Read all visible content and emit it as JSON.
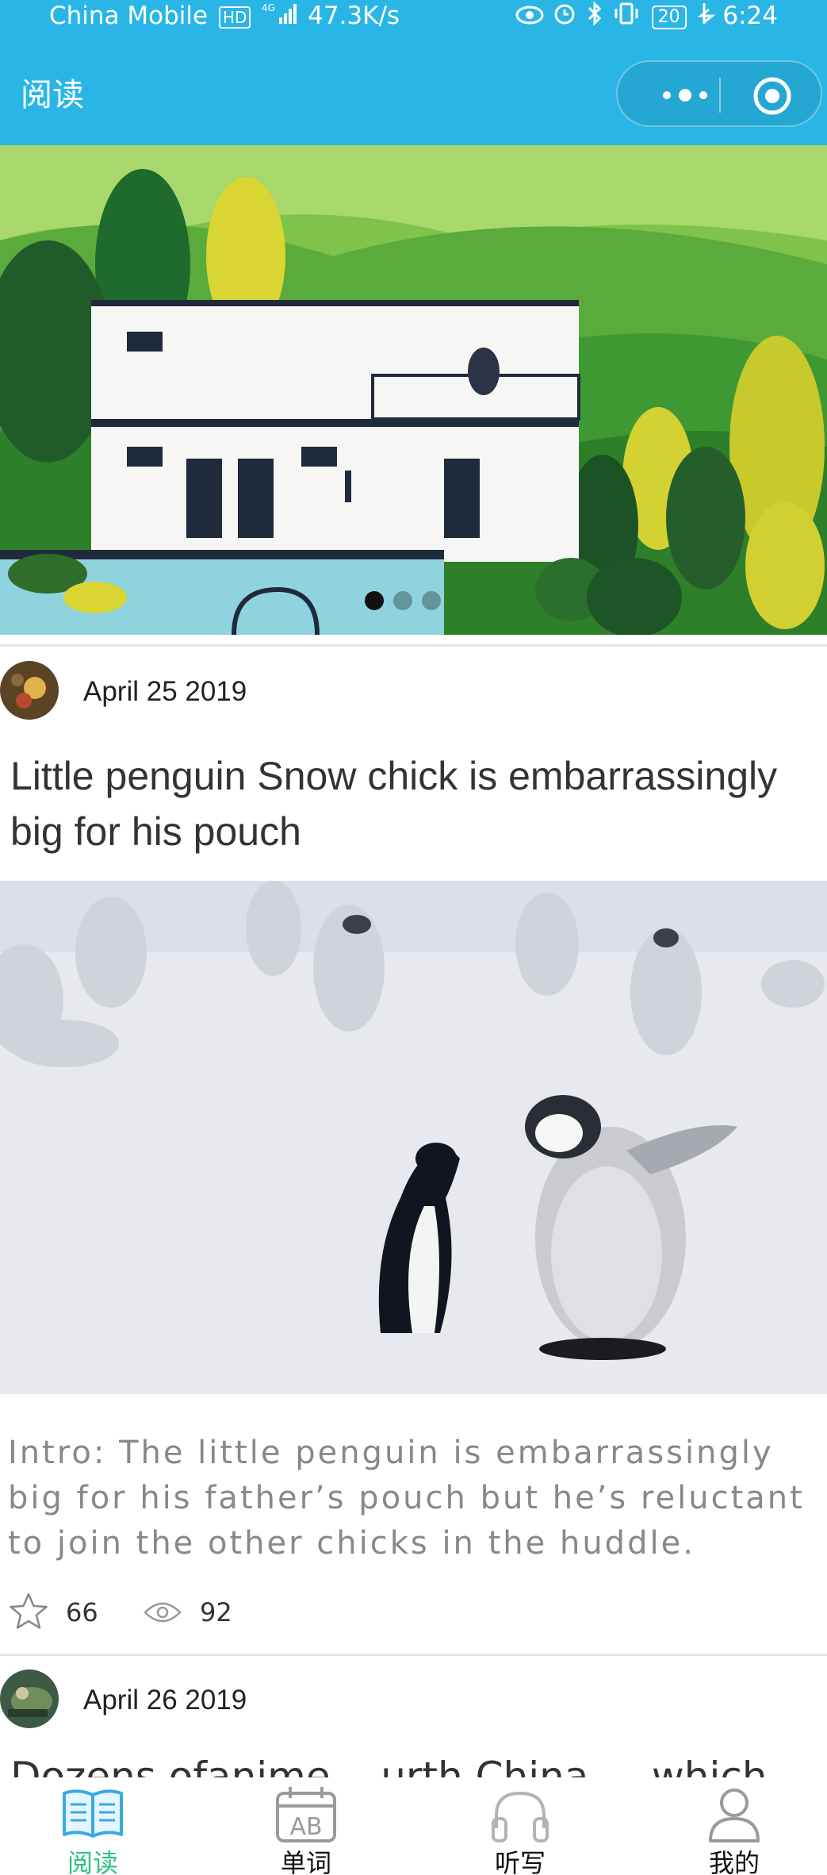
{
  "status_bar": {
    "carrier": "China Mobile",
    "hd": "HD",
    "network": "4G",
    "speed": "47.3K/s",
    "battery": "20",
    "time": "6:24"
  },
  "nav": {
    "title": "阅读"
  },
  "banner": {
    "dot_count": 3,
    "active_index": 0
  },
  "posts": [
    {
      "date": "April 25 2019",
      "title": "Little penguin Snow chick is embarrassingly big for his pouch",
      "intro": "Intro: The little penguin is embarrassingly big for his father’s pouch but he’s reluctant to join the other chicks in the huddle.",
      "stars": "66",
      "views": "92"
    },
    {
      "date": "April 26 2019",
      "title": "Dozens ofanime ...urth China ... which ..."
    }
  ],
  "tabbar": [
    {
      "label": "阅读",
      "icon": "book-icon",
      "active": true
    },
    {
      "label": "单词",
      "icon": "calendar-ab-icon",
      "active": false
    },
    {
      "label": "听写",
      "icon": "headphones-icon",
      "active": false
    },
    {
      "label": "我的",
      "icon": "user-icon",
      "active": false
    }
  ],
  "colors": {
    "header": "#29b6e6",
    "active_tab": "#2ec282"
  }
}
